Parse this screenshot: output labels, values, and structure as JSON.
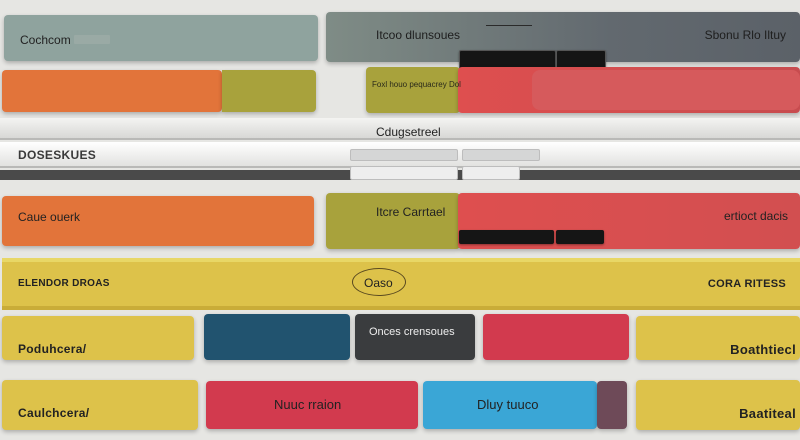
{
  "colors": {
    "orange": "#e2743a",
    "olive": "#a8a23c",
    "teal_gray": "#8fa39e",
    "slate": "#5f666e",
    "red": "#de4f4f",
    "yellow": "#ddc24a",
    "navy": "#21536f",
    "charcoal": "#3a3c3e",
    "crimson": "#d23a4e",
    "sky": "#3aa6d6",
    "plum": "#6e4a58"
  },
  "row1": {
    "left_label": "Cochcom",
    "center_label": "Itcoo dlunsoues",
    "right_label": "Sbonu Rlo Iltuy",
    "dark_pill_a": "",
    "dark_pill_b": ""
  },
  "row2": {
    "olive_label": "Foxl houo pequacrey Dol"
  },
  "row3": {
    "center_title": "Cdugsetreel",
    "left_label": "DOSESKUES"
  },
  "row4": {
    "left_label": "Caue ouerk",
    "center_label": "Itcre Carrtael",
    "right_label": "ertioct dacis"
  },
  "row5": {
    "left_label": "ELENDOR DROAS",
    "center_label": "Oaso",
    "right_label": "CORA RITESS"
  },
  "row6": {
    "left_label": "Poduhcera/",
    "center_label": "Onces crensoues",
    "right_label": "Boathtiecl"
  },
  "row7": {
    "left_label": "Caulchcera/",
    "red_label": "Nuuc rraion",
    "blue_label": "Dluy tuuco",
    "right_label": "Baatiteal"
  }
}
